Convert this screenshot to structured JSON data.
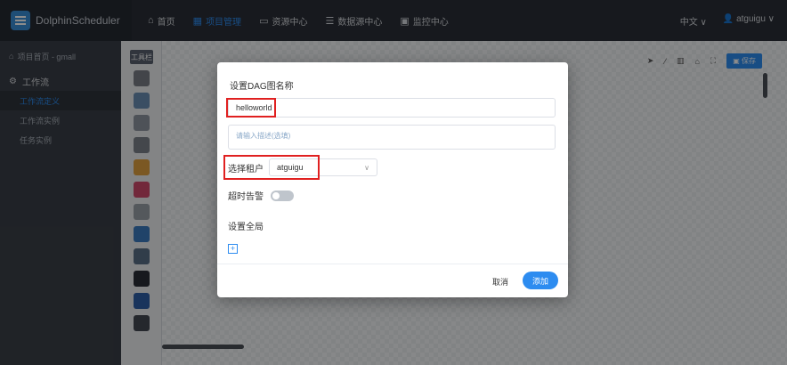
{
  "app": {
    "name": "DolphinScheduler"
  },
  "nav": {
    "items": [
      {
        "label": "首页",
        "icon": "home-icon"
      },
      {
        "label": "项目管理",
        "icon": "project-icon"
      },
      {
        "label": "资源中心",
        "icon": "folder-icon"
      },
      {
        "label": "数据源中心",
        "icon": "database-icon"
      },
      {
        "label": "监控中心",
        "icon": "monitor-icon"
      }
    ],
    "language": "中文",
    "user": "atguigu"
  },
  "sidebar": {
    "breadcrumb": "项目首页 - gmall",
    "group": "工作流",
    "items": [
      {
        "label": "工作流定义"
      },
      {
        "label": "工作流实例"
      },
      {
        "label": "任务实例"
      }
    ]
  },
  "toolbox": {
    "title": "工具栏",
    "tools": [
      {
        "icon": "shell-icon",
        "color": "#7a7f87"
      },
      {
        "icon": "sub-process-icon",
        "color": "#6b8fb5"
      },
      {
        "icon": "procedure-icon",
        "color": "#8f96a0"
      },
      {
        "icon": "sql-icon",
        "color": "#7c828b"
      },
      {
        "icon": "spark-icon",
        "color": "#e0a040"
      },
      {
        "icon": "flink-icon",
        "color": "#d04a6c"
      },
      {
        "icon": "mr-icon",
        "color": "#9aa0a8"
      },
      {
        "icon": "python-icon",
        "color": "#3b7bbf"
      },
      {
        "icon": "dependent-icon",
        "color": "#5a6f88"
      },
      {
        "icon": "http-icon",
        "color": "#2b2f37"
      },
      {
        "icon": "datax-icon",
        "color": "#2f5fa8"
      },
      {
        "icon": "sqoop-icon",
        "color": "#444a52"
      }
    ]
  },
  "canvas": {
    "save_label": "保存"
  },
  "dialog": {
    "title": "设置DAG图名称",
    "name_value": "helloworld",
    "desc_placeholder": "请输入描述(选填)",
    "tenant_label": "选择租户",
    "tenant_value": "atguigu",
    "timeout_label": "超时告警",
    "timeout_on": false,
    "global_label": "设置全局",
    "cancel_label": "取消",
    "add_label": "添加"
  }
}
